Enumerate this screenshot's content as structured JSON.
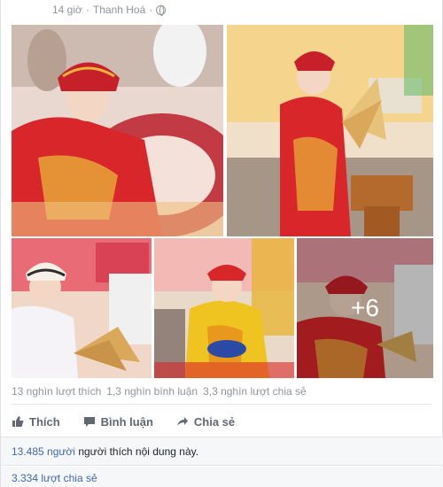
{
  "post": {
    "time": "14 giờ",
    "location": "Thanh Hoá",
    "separator": "·"
  },
  "photos": {
    "more_count": "+6"
  },
  "stats": {
    "likes": "13 nghìn lượt thích",
    "comments": "1,3 nghìn bình luận",
    "shares": "3,3 nghìn lượt chia sẻ"
  },
  "actions": {
    "like": "Thích",
    "comment": "Bình luận",
    "share": "Chia sẻ"
  },
  "footer": {
    "like_count": "13.485",
    "people_word": "người",
    "like_text": "người thích nội dung này.",
    "share_count_text": "3.334 lượt chia sẻ"
  },
  "colors": {
    "link": "#4267b2",
    "muted": "#90949c",
    "costume_red": "#d8262a",
    "costume_gold": "#e9b53a"
  }
}
